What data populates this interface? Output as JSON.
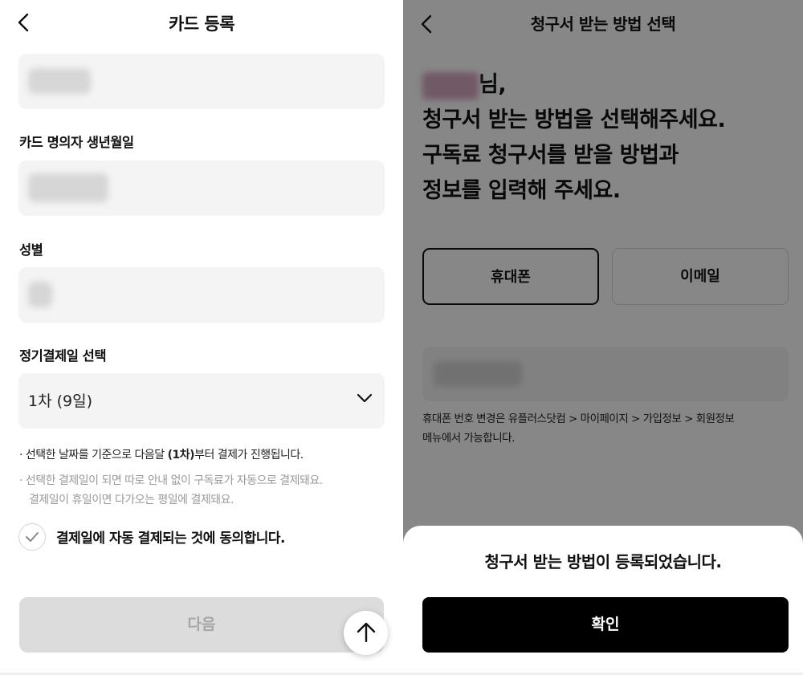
{
  "left": {
    "title": "카드 등록",
    "labels": {
      "birth": "카드 명의자 생년월일",
      "gender": "성별",
      "billing_day": "정기결제일 선택"
    },
    "billing_select": {
      "value": "1차 (9일)"
    },
    "note_main_pre": "· 선택한 날짜를 기준으로 다음달 ",
    "note_main_bold": "(1차)",
    "note_main_post": "부터 결제가 진행됩니다.",
    "note_sub_line1": "· 선택한 결제일이 되면 따로 안내 없이 구독료가 자동으로 결제돼요.",
    "note_sub_line2": "결제일이 휴일이면 다가오는 평일에 결제돼요.",
    "agree_text": "결제일에 자동 결제되는 것에 동의합니다.",
    "next_button": "다음"
  },
  "right": {
    "title": "청구서 받는 방법 선택",
    "heading_suffix": "님,",
    "heading_lines": [
      "청구서 받는 방법을 선택해주세요.",
      "구독료 청구서를 받을 방법과",
      "정보를 입력해 주세요."
    ],
    "tabs": {
      "phone": "휴대폰",
      "email": "이메일"
    },
    "phone_note_line1": "휴대폰 번호 변경은 유플러스닷컴 > 마이페이지 > 가입정보 > 회원정보",
    "phone_note_line2": "메뉴에서 가능합니다.",
    "sheet_title": "청구서 받는 방법이 등록되었습니다.",
    "confirm_button": "확인"
  },
  "icons": {
    "back": "chevron-left-icon",
    "dropdown": "chevron-down-icon",
    "check": "check-icon",
    "scroll_top": "arrow-up-icon"
  },
  "colors": {
    "overlay": "#000000",
    "confirm_bg": "#000000",
    "disabled_bg": "#dcdcdc",
    "field_bg": "#f4f4f4"
  }
}
